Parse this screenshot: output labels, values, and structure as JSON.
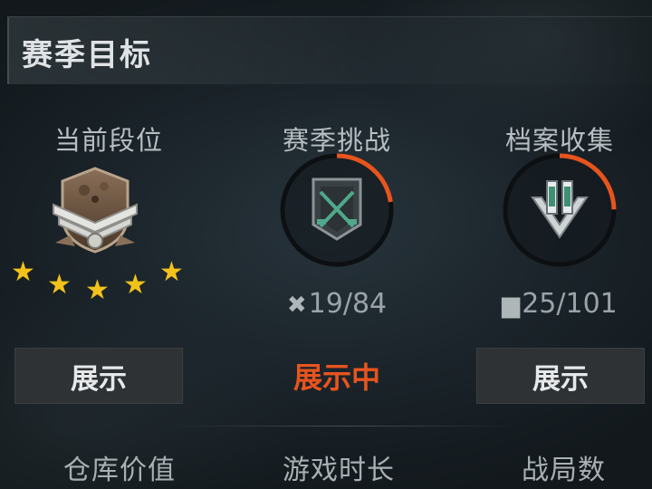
{
  "header": {
    "title": "赛季目标"
  },
  "rank": {
    "label": "当前段位",
    "stars": 5,
    "button_label": "展示"
  },
  "challenge": {
    "label": "赛季挑战",
    "current": "19",
    "total": "84",
    "counter_text": "19/84",
    "progress": 0.226,
    "status_label": "展示中",
    "icon": "crossed-rifles-icon"
  },
  "archive": {
    "label": "档案收集",
    "current": "25",
    "total": "101",
    "counter_text": "25/101",
    "progress": 0.248,
    "button_label": "展示",
    "icon": "document-icon"
  },
  "stats": {
    "warehouse_value_label": "仓库价值",
    "play_time_label": "游戏时长",
    "matches_label": "战局数"
  },
  "colors": {
    "accent": "#e8541e",
    "star": "#f2c21b"
  }
}
